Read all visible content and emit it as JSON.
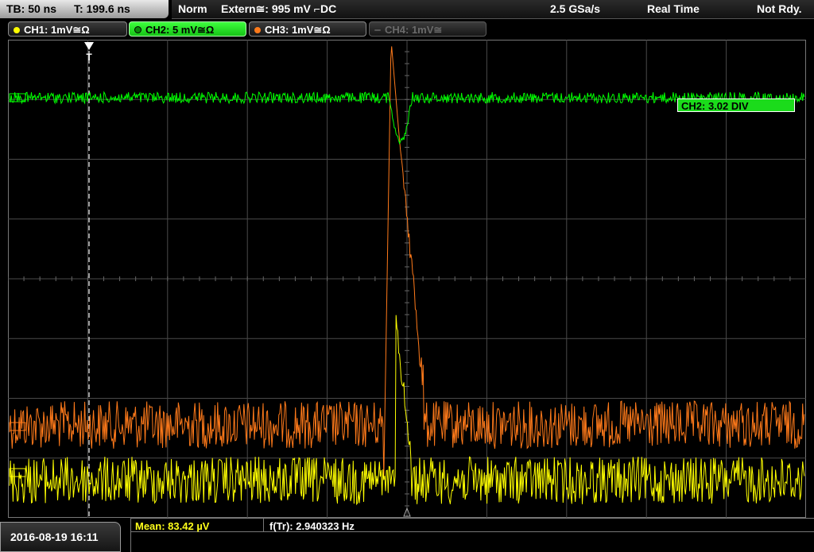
{
  "header": {
    "timebase": "TB: 50 ns",
    "trigger_time": "T: 199.6 ns",
    "trigger_mode": "Norm",
    "trigger_source": "Extern≅: 995 mV ⌐DC",
    "sample_rate": "2.5 GSa/s",
    "acq_mode": "Real Time",
    "status": "Not Rdy."
  },
  "channels": [
    {
      "label": "CH1: 1mV≅Ω",
      "color": "#ffff00",
      "active": true
    },
    {
      "label": "CH2: 5 mV≅Ω",
      "color": "#00ff00",
      "active": true,
      "selected": true
    },
    {
      "label": "CH3: 1mV≅Ω",
      "color": "#ff7a1a",
      "active": true
    },
    {
      "label": "CH4: 1mV≅",
      "color": "#6a6a6a",
      "active": false
    }
  ],
  "colors": {
    "ch1": "#ffff00",
    "ch2": "#00ff00",
    "ch3": "#ff7a1a",
    "grid": "#4a4a4a"
  },
  "display": {
    "ch2_offset": "CH2: 3.02 DIV",
    "trigger_marker": "T"
  },
  "measurements": {
    "mean": "Mean: 83.42 µV",
    "freq": "f(Tr): 2.940323 Hz"
  },
  "datetime": "2016-08-19 16:11"
}
